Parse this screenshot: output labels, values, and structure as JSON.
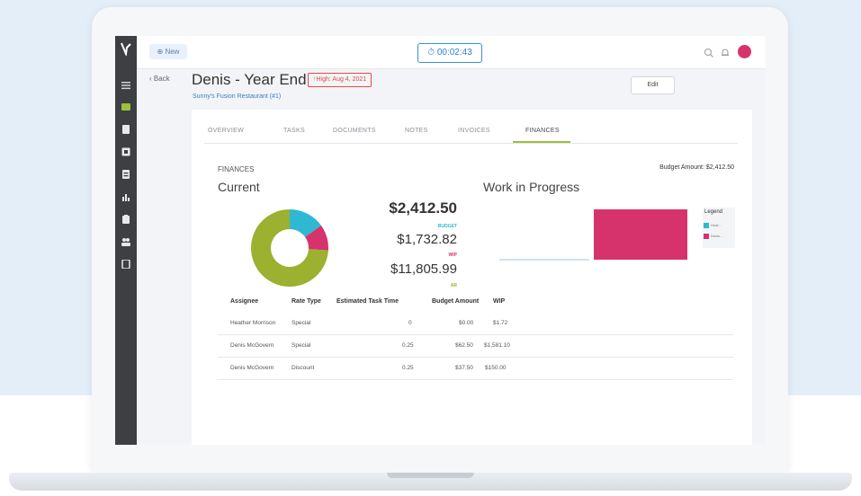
{
  "topbar": {
    "new_label": "New",
    "timer": "00:02:43"
  },
  "header": {
    "back_label": "Back",
    "title": "Denis - Year End",
    "priority": "High: Aug 4, 2021",
    "subtitle": "Sunny's Fusion Restaurant (#1)",
    "edit_label": "Edit"
  },
  "tabs": [
    {
      "label": "OVERVIEW"
    },
    {
      "label": "TASKS"
    },
    {
      "label": "DOCUMENTS"
    },
    {
      "label": "NOTES"
    },
    {
      "label": "INVOICES"
    },
    {
      "label": "FINANCES",
      "active": true
    }
  ],
  "finances": {
    "section_label": "FINANCES",
    "budget_amount": "Budget Amount: $2,412.50",
    "current_title": "Current",
    "wip_title": "Work in Progress",
    "budget_value": "$2,412.50",
    "budget_label": "BUDGET",
    "wip_value": "$1,732.82",
    "wip_label": "WIP",
    "ar_value": "$11,805.99",
    "ar_label": "AR",
    "legend_title": "Legend",
    "legend_items": [
      "Heat...",
      "Denis..."
    ]
  },
  "chart_data": {
    "type": "pie",
    "labels": [
      "BUDGET",
      "WIP",
      "AR"
    ],
    "values": [
      2412.5,
      1732.82,
      11805.99
    ],
    "colors": [
      "#2fb8d3",
      "#d6336c",
      "#9bb12f"
    ]
  },
  "table": {
    "headers": [
      "Assignee",
      "Rate Type",
      "Estimated Task Time",
      "Budget Amount",
      "WIP"
    ],
    "rows": [
      [
        "Heather Morrison",
        "Special",
        "0",
        "$0.00",
        "$1.72"
      ],
      [
        "Denis McGovern",
        "Special",
        "0.25",
        "$62.50",
        "$1,581.10"
      ],
      [
        "Denis McGovern",
        "Discount",
        "0.25",
        "$37.50",
        "$150.00"
      ]
    ]
  },
  "colors": {
    "accent": "#9bc03a",
    "link": "#3b7bc4",
    "pink": "#d6336c",
    "teal": "#2fb8d3"
  }
}
